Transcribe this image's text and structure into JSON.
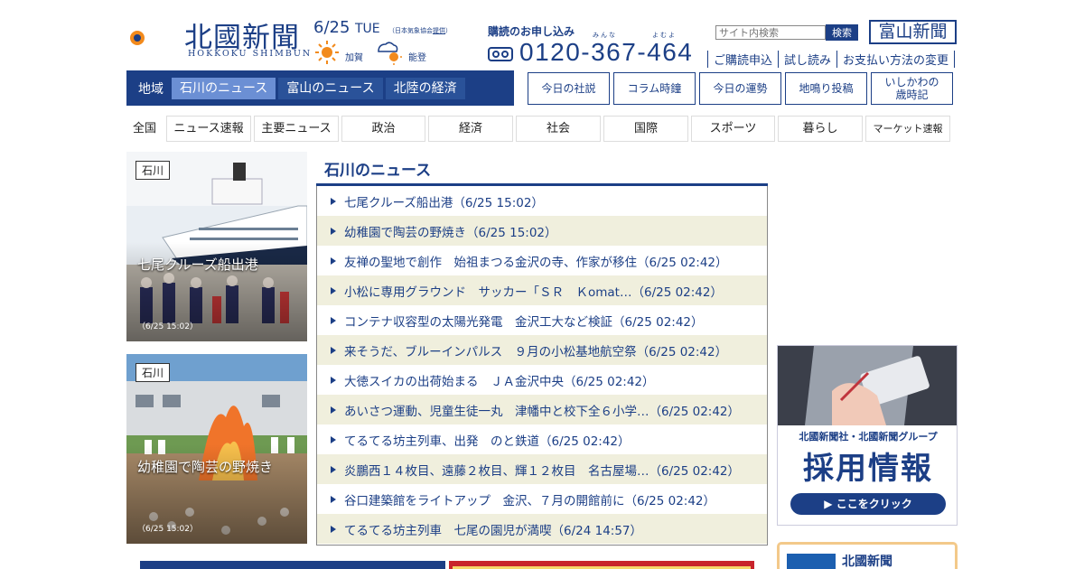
{
  "header": {
    "logo_ja": "北國新聞",
    "logo_en": "HOKKOKU SHIMBUN",
    "date": "6/25",
    "day_of_week": "TUE",
    "weather_credit_prefix": "（日本気象協会",
    "weather_credit_link": "提供",
    "weather_credit_suffix": "）",
    "weather": [
      {
        "region": "加賀",
        "icon": "sun-icon"
      },
      {
        "region": "能登",
        "icon": "cloud-sun-icon"
      }
    ],
    "subscribe_title": "購読のお申し込み",
    "ruby_1": "みんな",
    "ruby_2": "よむよ",
    "phone": "0120-367-464",
    "search_placeholder": "サイト内検索",
    "search_button": "検索",
    "toyama_logo": "富山新聞",
    "util_links": [
      "ご購読申込",
      "試し読み",
      "お支払い方法の変更"
    ]
  },
  "region_nav": {
    "label": "地域",
    "tabs": [
      "石川のニュース",
      "富山のニュース",
      "北陸の経済"
    ],
    "active_index": 0
  },
  "feature_buttons": [
    {
      "label": "今日の社説"
    },
    {
      "label": "コラム時鐘"
    },
    {
      "label": "今日の運勢"
    },
    {
      "label": "地鳴り投稿"
    },
    {
      "label_line1": "いしかわの",
      "label_line2": "歳時記"
    }
  ],
  "category_nav": {
    "first": "全国",
    "items": [
      "ニュース速報",
      "主要ニュース",
      "政治",
      "経済",
      "社会",
      "国際",
      "スポーツ",
      "暮らし",
      "マーケット速報"
    ]
  },
  "photo_cards": [
    {
      "tag": "石川",
      "caption": "七尾クルーズ船出港",
      "time": "（6/25 15:02）"
    },
    {
      "tag": "石川",
      "caption": "幼稚園で陶芸の野焼き",
      "time": "（6/25 15:02）"
    }
  ],
  "news": {
    "title": "石川のニュース",
    "items": [
      "七尾クルーズ船出港（6/25 15:02）",
      "幼稚園で陶芸の野焼き（6/25 15:02）",
      "友禅の聖地で創作　始祖まつる金沢の寺、作家が移住（6/25 02:42）",
      "小松に専用グラウンド　サッカー「ＳＲ　Ｋomat…（6/25 02:42）",
      "コンテナ収容型の太陽光発電　金沢工大など検証（6/25 02:42）",
      "来そうだ、ブルーインパルス　９月の小松基地航空祭（6/25 02:42）",
      "大徳スイカの出荷始まる　ＪＡ金沢中央（6/25 02:42）",
      "あいさつ運動、児童生徒一丸　津幡中と校下全６小学…（6/25 02:42）",
      "てるてる坊主列車、出発　のと鉄道（6/25 02:42）",
      "炎鵬西１４枚目、遠藤２枚目、輝１２枚目　名古屋場…（6/25 02:42）",
      "谷口建築館をライトアップ　金沢、７月の開館前に（6/25 02:42）",
      "てるてる坊主列車　七尾の園児が満喫（6/24 14:57）"
    ]
  },
  "recruit_banner": {
    "header": "北國新聞社・北國新聞グループ",
    "title": "採用情報",
    "cta": "▶ ここをクリック"
  },
  "side_box": {
    "title": "北國新聞"
  },
  "colors": {
    "brand": "#1c3f86",
    "active_tab": "#6b8fd4",
    "row_alt": "#f0efdd",
    "box_border": "#f3c98a"
  }
}
